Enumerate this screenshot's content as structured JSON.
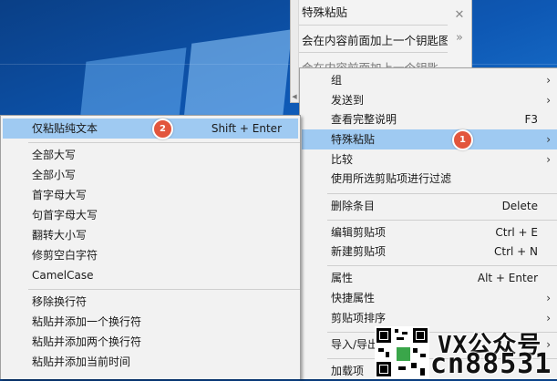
{
  "clipboard_window": {
    "items": [
      "特殊粘贴",
      "会在内容前面加上一个钥匙图",
      "会在内容前面加上一个钥匙"
    ],
    "close_glyph": "✕",
    "more_glyph": "»"
  },
  "context_menu": {
    "items": [
      {
        "label": "组",
        "accel": "",
        "arrow": "›"
      },
      {
        "label": "发送到",
        "accel": "",
        "arrow": "›"
      },
      {
        "label": "查看完整说明",
        "accel": "F3",
        "arrow": ""
      },
      {
        "label": "特殊粘贴",
        "accel": "",
        "arrow": "›",
        "badge": "1"
      },
      {
        "label": "比较",
        "accel": "",
        "arrow": "›"
      },
      {
        "label": "使用所选剪贴项进行过滤",
        "accel": "",
        "arrow": ""
      },
      {
        "label": "删除条目",
        "accel": "Delete",
        "arrow": ""
      },
      {
        "label": "编辑剪贴项",
        "accel": "Ctrl + E",
        "arrow": ""
      },
      {
        "label": "新建剪贴项",
        "accel": "Ctrl + N",
        "arrow": ""
      },
      {
        "label": "属性",
        "accel": "Alt + Enter",
        "arrow": ""
      },
      {
        "label": "快捷属性",
        "accel": "",
        "arrow": "›"
      },
      {
        "label": "剪贴项排序",
        "accel": "",
        "arrow": "›"
      },
      {
        "label": "导入/导出",
        "accel": "",
        "arrow": "›"
      },
      {
        "label": "加载项",
        "accel": "",
        "arrow": ""
      }
    ]
  },
  "paste_submenu": {
    "items": [
      {
        "label": "仅粘贴纯文本",
        "accel": "Shift + Enter",
        "badge": "2"
      },
      {
        "label": "全部大写",
        "accel": ""
      },
      {
        "label": "全部小写",
        "accel": ""
      },
      {
        "label": "首字母大写",
        "accel": ""
      },
      {
        "label": "句首字母大写",
        "accel": ""
      },
      {
        "label": "翻转大小写",
        "accel": ""
      },
      {
        "label": "修剪空白字符",
        "accel": ""
      },
      {
        "label": "CamelCase",
        "accel": ""
      },
      {
        "label": "移除换行符",
        "accel": ""
      },
      {
        "label": "粘贴并添加一个换行符",
        "accel": ""
      },
      {
        "label": "粘贴并添加两个换行符",
        "accel": ""
      },
      {
        "label": "粘贴并添加当前时间",
        "accel": ""
      }
    ]
  },
  "watermark": {
    "line1": "VX公众号",
    "line2": "cn88531"
  },
  "colors": {
    "highlight": "#9fcaf2",
    "badge": "#e2553c",
    "menu_bg": "#f2f2f2"
  }
}
